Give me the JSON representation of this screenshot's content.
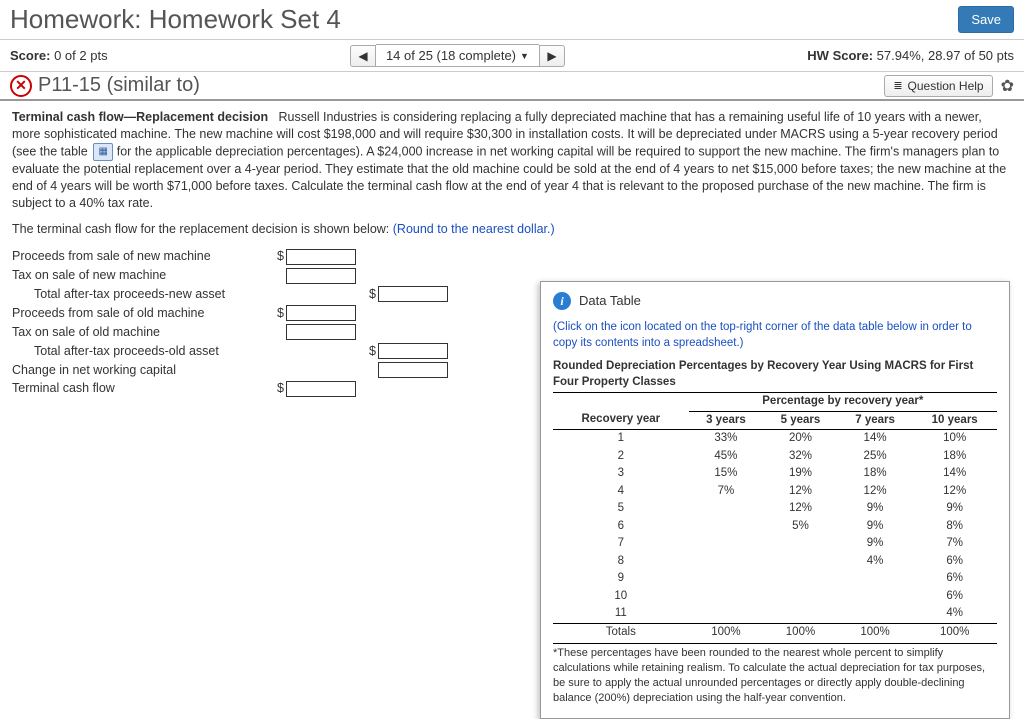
{
  "header": {
    "title": "Homework: Homework Set 4",
    "save": "Save"
  },
  "scorebar": {
    "score_label": "Score:",
    "score_value": "0 of 2 pts",
    "nav_text": "14 of 25 (18 complete)",
    "hw_label": "HW Score:",
    "hw_value": "57.94%, 28.97 of 50 pts"
  },
  "qbar": {
    "qnum": "P11-15 (similar to)",
    "help": "Question Help"
  },
  "problem": {
    "title": "Terminal cash flow—Replacement decision",
    "body1": "Russell Industries is considering replacing a fully depreciated machine that has a remaining useful life of 10 years with a newer, more sophisticated machine. The new machine will cost $198,000 and will require $30,300 in installation costs. It will be depreciated under MACRS using a 5-year recovery period (see the table",
    "body2": "for the applicable depreciation percentages). A $24,000 increase in net working capital will be required to support the new machine. The firm's managers plan to evaluate the potential replacement over a 4-year period. They estimate that the old machine could be sold at the end of 4 years to net $15,000 before taxes; the new machine at the end of 4 years will be worth $71,000 before taxes. Calculate the terminal cash flow at the end of year 4 that is relevant to the proposed purchase of the new machine. The firm is subject to a 40% tax rate.",
    "lead2": "The terminal cash flow for the replacement decision is shown below: ",
    "round": "(Round to the nearest dollar.)"
  },
  "cashflow": {
    "r1": "Proceeds from sale of new machine",
    "r2": "Tax on sale of new machine",
    "r3": "Total after-tax proceeds-new asset",
    "r4": "Proceeds from sale of old machine",
    "r5": "Tax on sale of old machine",
    "r6": "Total after-tax proceeds-old asset",
    "r7": "Change in net working capital",
    "r8": "Terminal cash flow"
  },
  "datatable": {
    "title": "Data Table",
    "instr": "(Click on the icon located on the top-right corner of the data table below in order to copy its contents into a spreadsheet.)",
    "tname": "Rounded Depreciation Percentages by Recovery Year Using MACRS for First Four Property Classes",
    "span": "Percentage by recovery year*",
    "col_recov": "Recovery year",
    "col_3": "3 years",
    "col_5": "5 years",
    "col_7": "7 years",
    "col_10": "10 years",
    "totals_label": "Totals",
    "footnote": "*These percentages have been rounded to the nearest whole percent to simplify calculations while retaining realism. To calculate the actual depreciation for tax purposes, be sure to apply the actual unrounded percentages or directly apply double-declining balance (200%) depreciation using the half-year convention."
  },
  "chart_data": {
    "type": "table",
    "title": "Rounded Depreciation Percentages by Recovery Year Using MACRS for First Four Property Classes",
    "columns": [
      "Recovery year",
      "3 years",
      "5 years",
      "7 years",
      "10 years"
    ],
    "rows": [
      [
        "1",
        "33%",
        "20%",
        "14%",
        "10%"
      ],
      [
        "2",
        "45%",
        "32%",
        "25%",
        "18%"
      ],
      [
        "3",
        "15%",
        "19%",
        "18%",
        "14%"
      ],
      [
        "4",
        "7%",
        "12%",
        "12%",
        "12%"
      ],
      [
        "5",
        "",
        "12%",
        "9%",
        "9%"
      ],
      [
        "6",
        "",
        "5%",
        "9%",
        "8%"
      ],
      [
        "7",
        "",
        "",
        "9%",
        "7%"
      ],
      [
        "8",
        "",
        "",
        "4%",
        "6%"
      ],
      [
        "9",
        "",
        "",
        "",
        "6%"
      ],
      [
        "10",
        "",
        "",
        "",
        "6%"
      ],
      [
        "11",
        "",
        "",
        "",
        "4%"
      ]
    ],
    "totals": [
      "Totals",
      "100%",
      "100%",
      "100%",
      "100%"
    ]
  }
}
